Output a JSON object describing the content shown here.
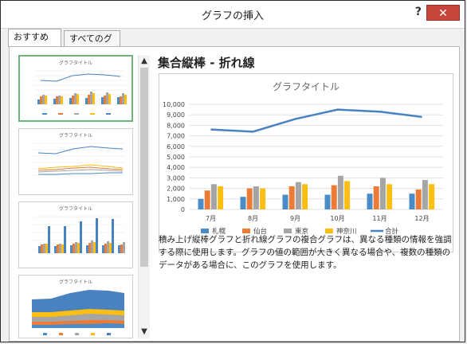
{
  "dialog": {
    "title": "グラフの挿入",
    "help_label": "?",
    "close_label": "✕"
  },
  "tabs": [
    "おすすめグラフ",
    "すべてのグラフ"
  ],
  "recommended": {
    "thumbnail_titles": [
      "グラフタイトル",
      "グラフタイトル",
      "グラフタイトル",
      "グラフタイトル"
    ],
    "selected_index": 0
  },
  "selected": {
    "name": "集合縦棒 - 折れ線",
    "description": "積み上げ縦棒グラフと折れ線グラフの複合グラフは、異なる種類の情報を強調する際に使用します。グラフの値の範囲が大きく異なる場合や、複数の種類のデータがある場合に、このグラフを使用します。"
  },
  "chart_data": {
    "type": "bar",
    "title": "グラフタイトル",
    "categories": [
      "7月",
      "8月",
      "9月",
      "10月",
      "11月",
      "12月"
    ],
    "ylim": [
      0,
      10000
    ],
    "yticks": [
      "0",
      "1,000",
      "2,000",
      "3,000",
      "4,000",
      "5,000",
      "6,000",
      "7,000",
      "8,000",
      "9,000",
      "10,000"
    ],
    "series": [
      {
        "name": "札幌",
        "kind": "bar",
        "color": "#4a8cc7",
        "values": [
          1000,
          1200,
          1400,
          1400,
          1500,
          1500
        ]
      },
      {
        "name": "仙台",
        "kind": "bar",
        "color": "#ec7b37",
        "values": [
          1800,
          2000,
          2200,
          2300,
          2200,
          1900
        ]
      },
      {
        "name": "東京",
        "kind": "bar",
        "color": "#a5a5a5",
        "values": [
          2400,
          2200,
          2600,
          3200,
          3000,
          2800
        ]
      },
      {
        "name": "神奈川",
        "kind": "bar",
        "color": "#fcbe11",
        "values": [
          2200,
          2000,
          2400,
          2700,
          2400,
          2400
        ]
      },
      {
        "name": "合計",
        "kind": "line",
        "color": "#4a82c1",
        "values": [
          7600,
          7400,
          8600,
          9500,
          9300,
          8800
        ]
      }
    ],
    "grid": true,
    "legend": "bottom"
  }
}
